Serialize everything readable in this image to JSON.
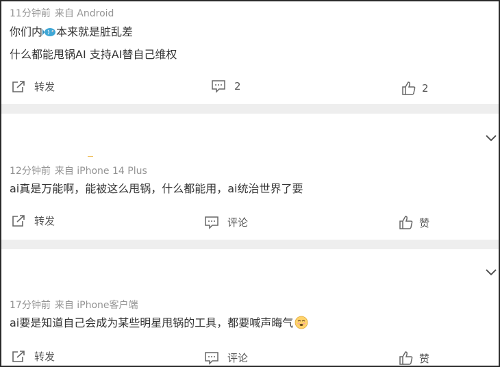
{
  "comments": [
    {
      "meta_time": "11分钟前",
      "meta_source": "来自 Android",
      "lines": [
        "你们内",
        "本来就是脏乱差",
        "什么都能甩锅AI 支持AI替自己维权"
      ],
      "repost_label": "转发",
      "comment_count": "2",
      "like_count": "2"
    },
    {
      "meta_time": "12分钟前",
      "meta_source": "来自 iPhone 14 Plus",
      "text": "ai真是万能啊，能被这么甩锅，什么都能用，ai统治世界了要",
      "repost_label": "转发",
      "comment_label": "评论",
      "like_label": "赞"
    },
    {
      "meta_time": "17分钟前",
      "meta_source": "来自 iPhone客户端",
      "text": "ai要是知道自己会成为某些明星甩锅的工具，都要喊声晦气",
      "repost_label": "转发",
      "comment_label": "评论",
      "like_label": "赞"
    }
  ],
  "colors": {
    "meta": "#939393",
    "text": "#333333",
    "separator": "#eeeeee",
    "icon": "#666666"
  }
}
